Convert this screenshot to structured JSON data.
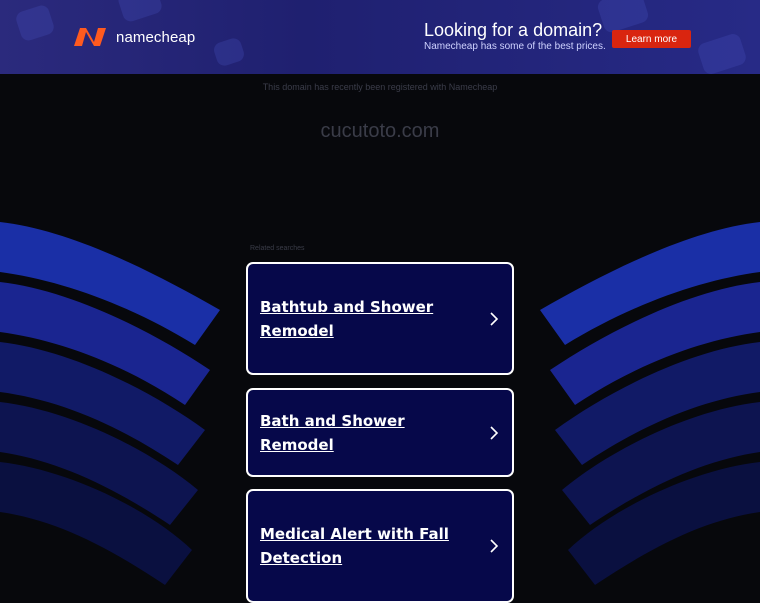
{
  "banner": {
    "logo_text": "namecheap",
    "promo_title": "Looking for a domain?",
    "promo_subtitle": "Namecheap has some of the best prices.",
    "button_label": "Learn more",
    "colors": {
      "background": "#23247a",
      "button": "#d9250f",
      "logo_mark": "#ff5a1f"
    }
  },
  "notice": "This domain has recently been registered with Namecheap",
  "domain_name": "cucutoto.com",
  "related": {
    "label": "Related searches",
    "items": [
      {
        "label": "Bathtub and Shower Remodel",
        "icon": "chevron-right-icon"
      },
      {
        "label": "Bath and Shower Remodel",
        "icon": "chevron-right-icon"
      },
      {
        "label": "Medical Alert with Fall Detection",
        "icon": "chevron-right-icon"
      }
    ]
  },
  "colors": {
    "page_bg": "#07080c",
    "card_bg": "#06084a",
    "wave": "#1a2aa0"
  }
}
